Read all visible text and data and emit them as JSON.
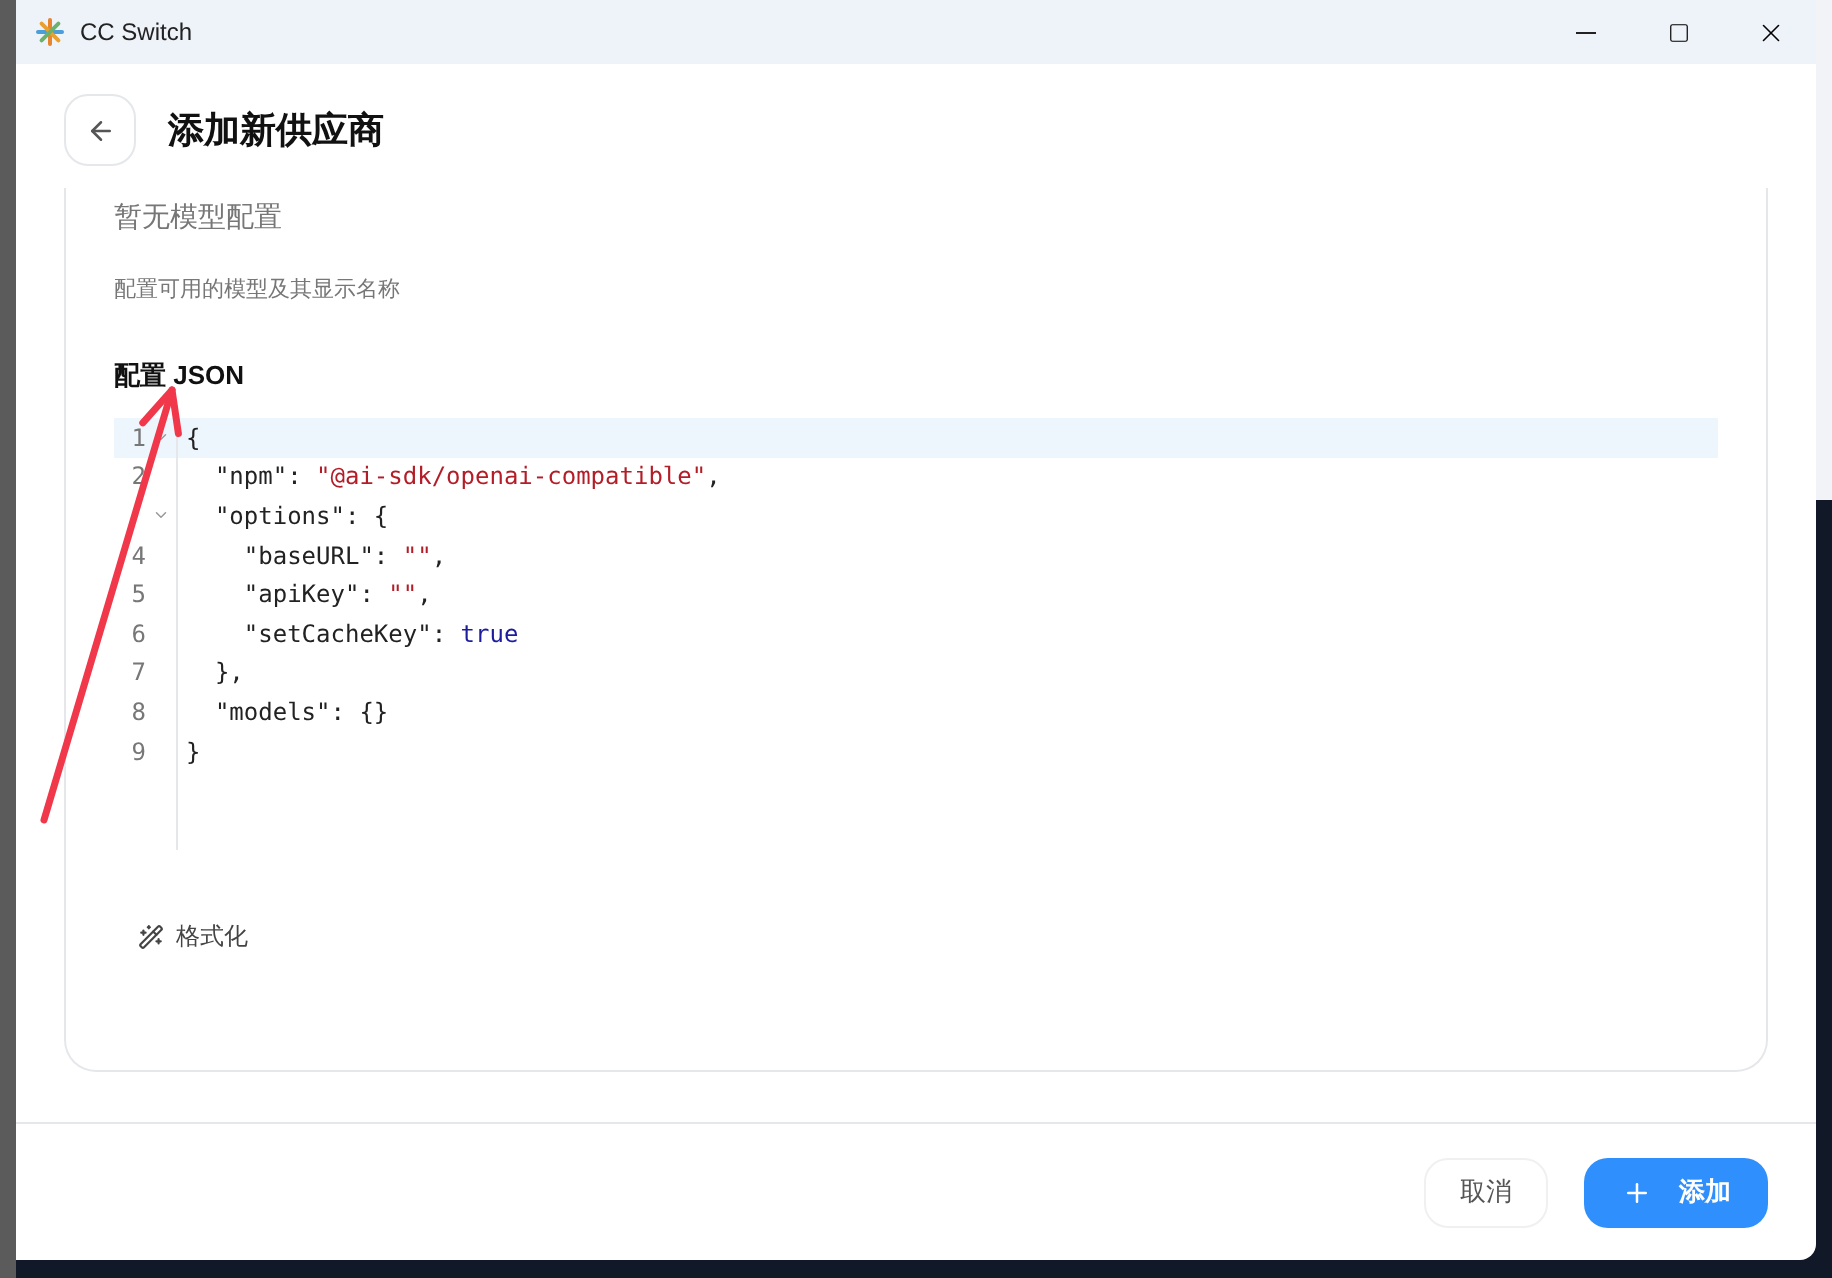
{
  "window": {
    "title": "CC Switch"
  },
  "header": {
    "title": "添加新供应商"
  },
  "models": {
    "empty_text": "暂无模型配置",
    "hint": "配置可用的模型及其显示名称"
  },
  "config": {
    "label": "配置 JSON",
    "lines": [
      {
        "number": "1",
        "foldable": true,
        "highlighted": true,
        "tokens": [
          {
            "kind": "punct",
            "text": "{"
          }
        ]
      },
      {
        "number": "2",
        "foldable": false,
        "highlighted": false,
        "tokens": [
          {
            "kind": "key",
            "text": "  \"npm\""
          },
          {
            "kind": "punct",
            "text": ": "
          },
          {
            "kind": "string",
            "text": "\"@ai-sdk/openai-compatible\""
          },
          {
            "kind": "punct",
            "text": ","
          }
        ]
      },
      {
        "foldable": true,
        "highlighted": false,
        "tokens": [
          {
            "kind": "key",
            "text": "  \"options\""
          },
          {
            "kind": "punct",
            "text": ": {"
          }
        ]
      },
      {
        "number": "4",
        "foldable": false,
        "highlighted": false,
        "tokens": [
          {
            "kind": "key",
            "text": "    \"baseURL\""
          },
          {
            "kind": "punct",
            "text": ": "
          },
          {
            "kind": "string",
            "text": "\"\""
          },
          {
            "kind": "punct",
            "text": ","
          }
        ]
      },
      {
        "number": "5",
        "foldable": false,
        "highlighted": false,
        "tokens": [
          {
            "kind": "key",
            "text": "    \"apiKey\""
          },
          {
            "kind": "punct",
            "text": ": "
          },
          {
            "kind": "string",
            "text": "\"\""
          },
          {
            "kind": "punct",
            "text": ","
          }
        ]
      },
      {
        "number": "6",
        "foldable": false,
        "highlighted": false,
        "tokens": [
          {
            "kind": "key",
            "text": "    \"setCacheKey\""
          },
          {
            "kind": "punct",
            "text": ": "
          },
          {
            "kind": "keyword",
            "text": "true"
          }
        ]
      },
      {
        "number": "7",
        "foldable": false,
        "highlighted": false,
        "tokens": [
          {
            "kind": "punct",
            "text": "  },"
          }
        ]
      },
      {
        "number": "8",
        "foldable": false,
        "highlighted": false,
        "tokens": [
          {
            "kind": "key",
            "text": "  \"models\""
          },
          {
            "kind": "punct",
            "text": ": {}"
          }
        ]
      },
      {
        "number": "9",
        "foldable": false,
        "highlighted": false,
        "tokens": [
          {
            "kind": "punct",
            "text": "}"
          }
        ]
      }
    ],
    "format_button": "格式化"
  },
  "footer": {
    "cancel": "取消",
    "submit": "添加"
  }
}
